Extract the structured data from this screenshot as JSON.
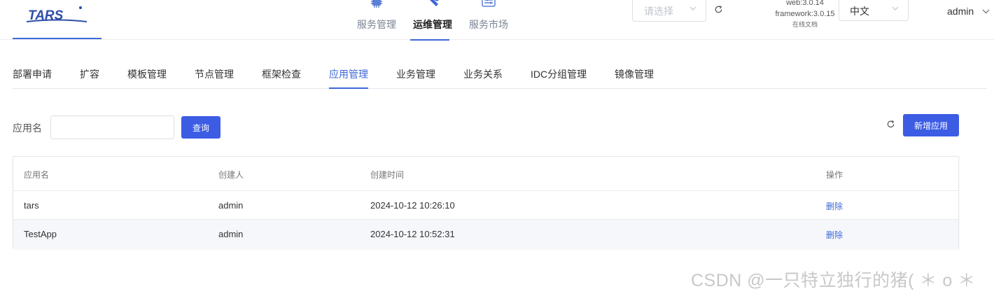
{
  "header": {
    "logo_text": "TARS",
    "nav": [
      {
        "label": "服务管理",
        "icon": "chip-icon"
      },
      {
        "label": "运维管理",
        "icon": "tools-icon"
      },
      {
        "label": "服务市场",
        "icon": "market-icon"
      }
    ],
    "active_nav_index": 1,
    "env_select": {
      "placeholder": "请选择"
    },
    "version": {
      "web": "web:3.0.14",
      "framework": "framework:3.0.15",
      "docs": "在线文档"
    },
    "lang_select": {
      "value": "中文"
    },
    "user": "admin"
  },
  "subtabs": [
    {
      "label": "部署申请"
    },
    {
      "label": "扩容"
    },
    {
      "label": "模板管理"
    },
    {
      "label": "节点管理"
    },
    {
      "label": "框架检查"
    },
    {
      "label": "应用管理"
    },
    {
      "label": "业务管理"
    },
    {
      "label": "业务关系"
    },
    {
      "label": "IDC分组管理"
    },
    {
      "label": "镜像管理"
    }
  ],
  "active_subtab_index": 5,
  "filter": {
    "label": "应用名",
    "input_value": "",
    "query_button": "查询",
    "add_button": "新增应用"
  },
  "table": {
    "columns": [
      "应用名",
      "创建人",
      "创建时间",
      "操作"
    ],
    "rows": [
      {
        "name": "tars",
        "creator": "admin",
        "created": "2024-10-12 10:26:10",
        "action": "删除"
      },
      {
        "name": "TestApp",
        "creator": "admin",
        "created": "2024-10-12 10:52:31",
        "action": "删除"
      }
    ]
  },
  "watermark": "CSDN @一只特立独行的猪( ＊ o ＊",
  "colors": {
    "accent": "#3c68d8",
    "button": "#3c5ce4"
  }
}
